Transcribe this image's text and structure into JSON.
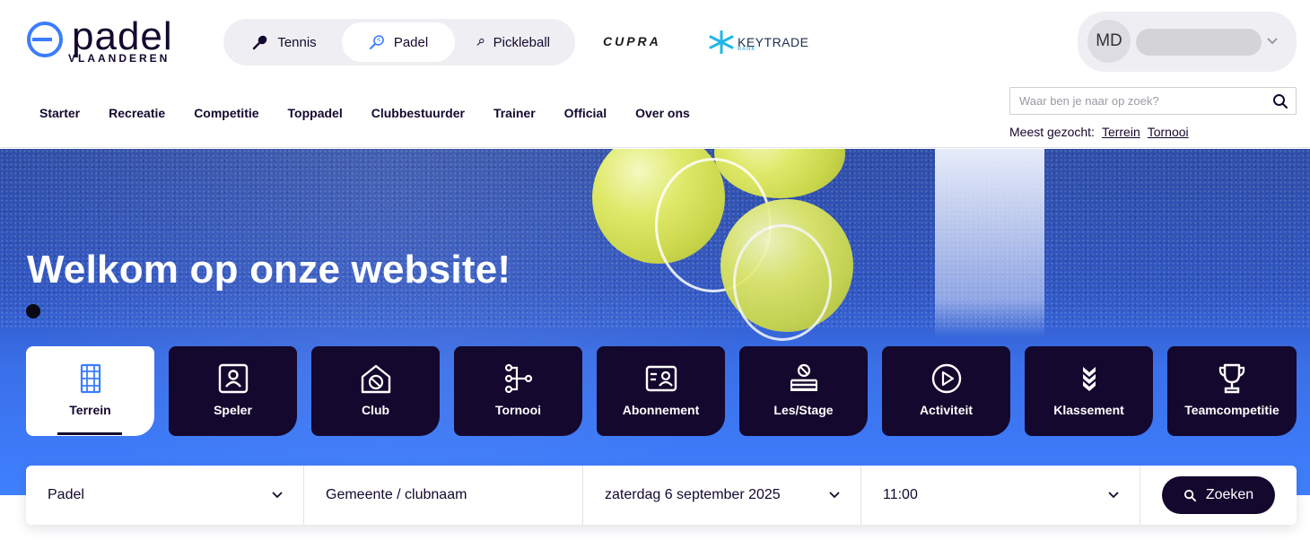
{
  "brand": {
    "logo_word": "padel",
    "logo_sub": "VLAANDEREN"
  },
  "sport_switch": [
    {
      "label": "Tennis",
      "icon": "tennis-racket-icon",
      "active": false
    },
    {
      "label": "Padel",
      "icon": "padel-racket-icon",
      "active": true
    },
    {
      "label": "Pickleball",
      "icon": "pickleball-paddle-icon",
      "active": false
    }
  ],
  "sponsors": {
    "cupra": "CUPRA",
    "keytrade": "KEYTRADE",
    "keytrade_sub": "BANK"
  },
  "user": {
    "initials": "MD"
  },
  "main_nav": [
    "Starter",
    "Recreatie",
    "Competitie",
    "Toppadel",
    "Clubbestuurder",
    "Trainer",
    "Official",
    "Over ons"
  ],
  "search": {
    "placeholder": "Waar ben je naar op zoek?",
    "most_searched_label": "Meest gezocht:",
    "most_searched_links": [
      "Terrein",
      "Tornooi"
    ]
  },
  "hero": {
    "title": "Welkom op onze website!"
  },
  "tiles": [
    {
      "label": "Terrein",
      "icon": "court-icon",
      "active": true
    },
    {
      "label": "Speler",
      "icon": "player-icon",
      "active": false
    },
    {
      "label": "Club",
      "icon": "clubhouse-icon",
      "active": false
    },
    {
      "label": "Tornooi",
      "icon": "tournament-bracket-icon",
      "active": false
    },
    {
      "label": "Abonnement",
      "icon": "membership-card-icon",
      "active": false
    },
    {
      "label": "Les/Stage",
      "icon": "lesson-icon",
      "active": false
    },
    {
      "label": "Activiteit",
      "icon": "play-circle-icon",
      "active": false
    },
    {
      "label": "Klassement",
      "icon": "ranking-chevrons-icon",
      "active": false
    },
    {
      "label": "Teamcompetitie",
      "icon": "trophy-icon",
      "active": false
    }
  ],
  "finder": {
    "sport": "Padel",
    "location": "Gemeente / clubnaam",
    "date": "zaterdag 6 september 2025",
    "time": "11:00",
    "button": "Zoeken"
  },
  "colors": {
    "brand_dark": "#14082e",
    "hero_blue": "#3f80ff",
    "logo_blue": "#3b7cff"
  }
}
